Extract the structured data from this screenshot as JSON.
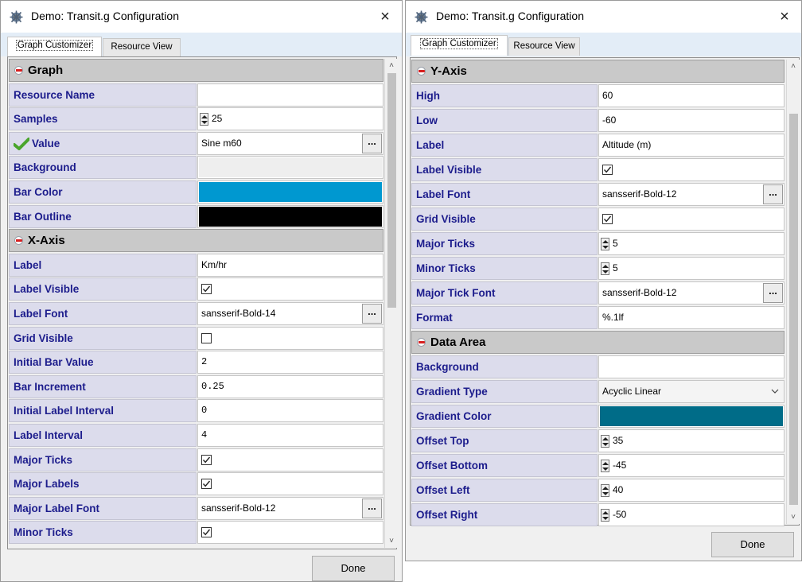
{
  "left": {
    "title": "Demo: Transit.g Configuration",
    "close": "×",
    "tabs": [
      "Graph Customizer",
      "Resource View"
    ],
    "done_label": "Done",
    "sections": [
      {
        "header": "Graph",
        "rows": [
          {
            "name": "Resource Name",
            "type": "text",
            "value": ""
          },
          {
            "name": "Samples",
            "type": "spinner",
            "value": "25"
          },
          {
            "name": "Value",
            "type": "file",
            "value": "Sine m60",
            "icon": "check-icon",
            "button": "..."
          },
          {
            "name": "Background",
            "type": "color",
            "color": "#eeeeee"
          },
          {
            "name": "Bar Color",
            "type": "color",
            "color": "#0098d0"
          },
          {
            "name": "Bar Outline",
            "type": "color",
            "color": "#000000"
          }
        ]
      },
      {
        "header": "X-Axis",
        "rows": [
          {
            "name": "Label",
            "type": "text",
            "value": "Km/hr"
          },
          {
            "name": "Label Visible",
            "type": "checkbox",
            "checked": true
          },
          {
            "name": "Label Font",
            "type": "file",
            "value": "sansserif-Bold-14",
            "button": "..."
          },
          {
            "name": "Grid Visible",
            "type": "checkbox",
            "checked": false
          },
          {
            "name": "Initial Bar Value",
            "type": "text",
            "value": "2",
            "mono": true
          },
          {
            "name": "Bar Increment",
            "type": "text",
            "value": "0.25",
            "mono": true
          },
          {
            "name": "Initial Label Interval",
            "type": "text",
            "value": "0",
            "mono": true
          },
          {
            "name": "Label Interval",
            "type": "text",
            "value": "4",
            "mono": true
          },
          {
            "name": "Major Ticks",
            "type": "checkbox",
            "checked": true
          },
          {
            "name": "Major Labels",
            "type": "checkbox",
            "checked": true
          },
          {
            "name": "Major Label Font",
            "type": "file",
            "value": "sansserif-Bold-12",
            "button": "..."
          },
          {
            "name": "Minor Ticks",
            "type": "checkbox",
            "checked": true
          }
        ]
      }
    ]
  },
  "right": {
    "title": "Demo: Transit.g Configuration",
    "close": "×",
    "tabs": [
      "Graph Customizer",
      "Resource View"
    ],
    "done_label": "Done",
    "sections": [
      {
        "header": "Y-Axis",
        "rows": [
          {
            "name": "High",
            "type": "text",
            "value": "60"
          },
          {
            "name": "Low",
            "type": "text",
            "value": "-60"
          },
          {
            "name": "Label",
            "type": "text",
            "value": "Altitude (m)"
          },
          {
            "name": "Label Visible",
            "type": "checkbox",
            "checked": true
          },
          {
            "name": "Label Font",
            "type": "file",
            "value": "sansserif-Bold-12",
            "button": "..."
          },
          {
            "name": "Grid Visible",
            "type": "checkbox",
            "checked": true
          },
          {
            "name": "Major Ticks",
            "type": "spinner",
            "value": "5"
          },
          {
            "name": "Minor Ticks",
            "type": "spinner",
            "value": "5"
          },
          {
            "name": "Major Tick Font",
            "type": "file",
            "value": "sansserif-Bold-12",
            "button": "..."
          },
          {
            "name": "Format",
            "type": "text",
            "value": "%.1lf"
          }
        ]
      },
      {
        "header": "Data Area",
        "rows": [
          {
            "name": "Background",
            "type": "text",
            "value": ""
          },
          {
            "name": "Gradient Type",
            "type": "dropdown",
            "value": "Acyclic Linear"
          },
          {
            "name": "Gradient Color",
            "type": "color",
            "color": "#006c88"
          },
          {
            "name": "Offset Top",
            "type": "spinner",
            "value": "35"
          },
          {
            "name": "Offset Bottom",
            "type": "spinner",
            "value": "-45"
          },
          {
            "name": "Offset Left",
            "type": "spinner",
            "value": "40"
          },
          {
            "name": "Offset Right",
            "type": "spinner",
            "value": "-50"
          }
        ]
      }
    ]
  }
}
